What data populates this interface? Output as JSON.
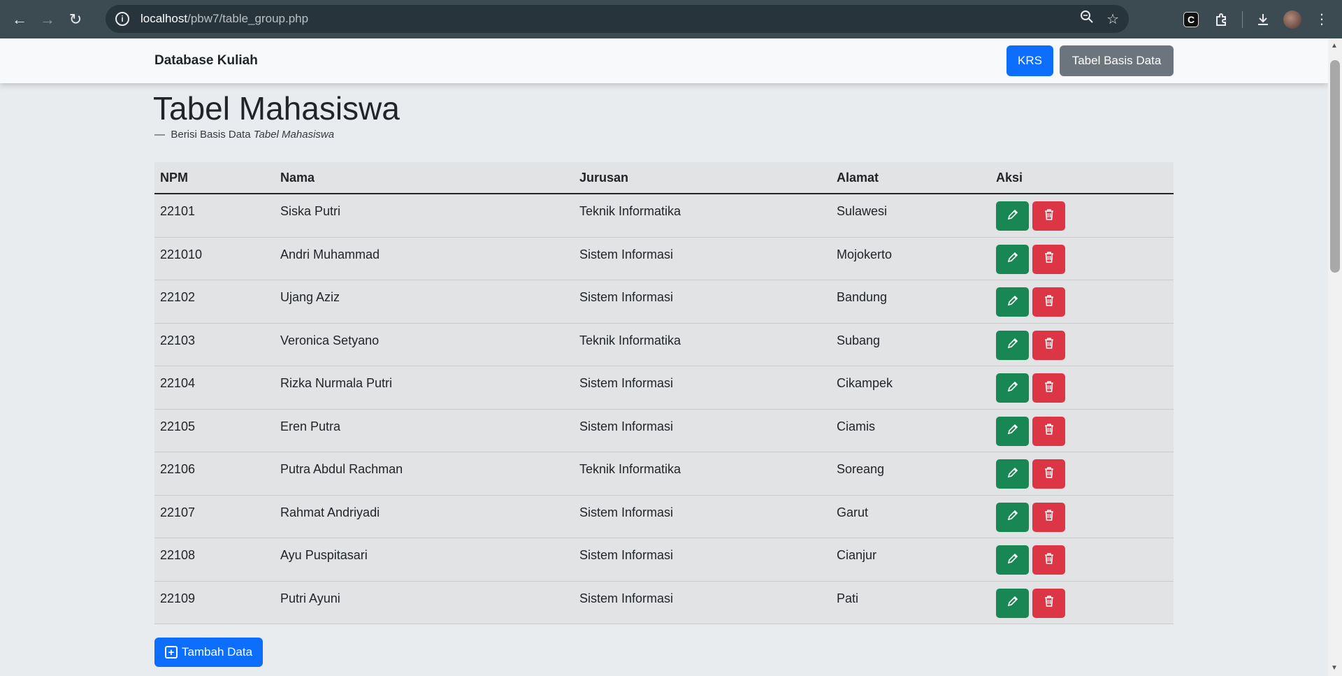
{
  "browser": {
    "url_host": "localhost",
    "url_path": "/pbw7/table_group.php"
  },
  "navbar": {
    "brand": "Database Kuliah",
    "krs_label": "KRS",
    "tabel_label": "Tabel Basis Data"
  },
  "page": {
    "title": "Tabel Mahasiswa",
    "subtitle_dash": "—",
    "subtitle_text": "Berisi Basis Data",
    "subtitle_em": "Tabel Mahasiswa"
  },
  "table": {
    "headers": [
      "NPM",
      "Nama",
      "Jurusan",
      "Alamat",
      "Aksi"
    ],
    "rows": [
      [
        "22101",
        "Siska Putri",
        "Teknik Informatika",
        "Sulawesi"
      ],
      [
        "221010",
        "Andri Muhammad",
        "Sistem Informasi",
        "Mojokerto"
      ],
      [
        "22102",
        "Ujang Aziz",
        "Sistem Informasi",
        "Bandung"
      ],
      [
        "22103",
        "Veronica Setyano",
        "Teknik Informatika",
        "Subang"
      ],
      [
        "22104",
        "Rizka Nurmala Putri",
        "Sistem Informasi",
        "Cikampek"
      ],
      [
        "22105",
        "Eren Putra",
        "Sistem Informasi",
        "Ciamis"
      ],
      [
        "22106",
        "Putra Abdul Rachman",
        "Teknik Informatika",
        "Soreang"
      ],
      [
        "22107",
        "Rahmat Andriyadi",
        "Sistem Informasi",
        "Garut"
      ],
      [
        "22108",
        "Ayu Puspitasari",
        "Sistem Informasi",
        "Cianjur"
      ],
      [
        "22109",
        "Putri Ayuni",
        "Sistem Informasi",
        "Pati"
      ]
    ]
  },
  "actions": {
    "add_label": "Tambah Data"
  },
  "colors": {
    "primary": "#0d6efd",
    "secondary": "#6c757d",
    "success": "#198754",
    "danger": "#dc3545"
  }
}
